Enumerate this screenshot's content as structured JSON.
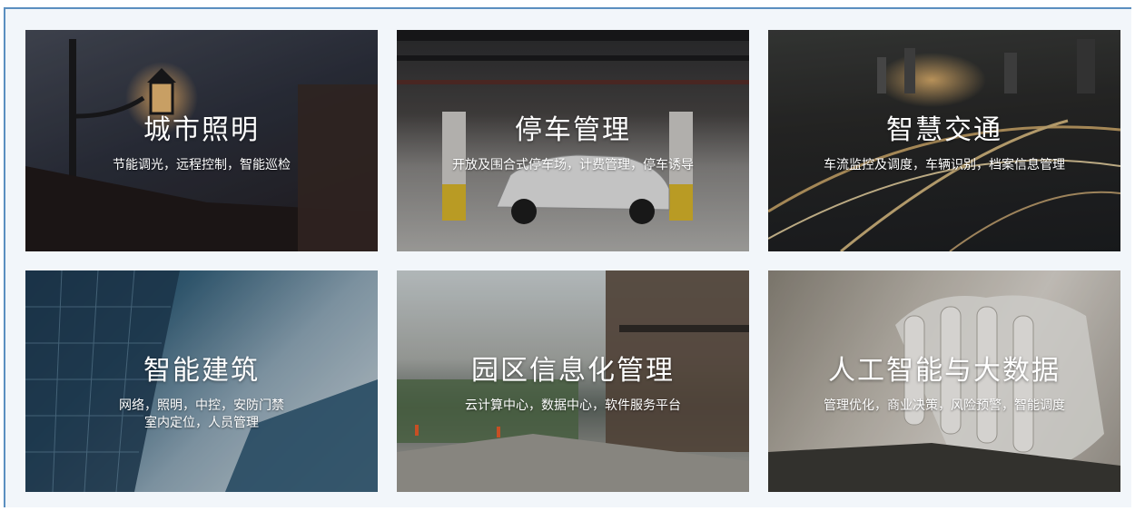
{
  "cards": [
    {
      "title": "城市照明",
      "desc": "节能调光，远程控制，智能巡检"
    },
    {
      "title": "停车管理",
      "desc": "开放及围合式停车场，计费管理，停车诱导"
    },
    {
      "title": "智慧交通",
      "desc": "车流监控及调度，车辆识别，档案信息管理"
    },
    {
      "title": "智能建筑",
      "desc": "网络，照明，中控，安防门禁\n室内定位，人员管理"
    },
    {
      "title": "园区信息化管理",
      "desc": "云计算中心，数据中心，软件服务平台"
    },
    {
      "title": "人工智能与大数据",
      "desc": "管理优化，商业决策，风险预警，智能调度"
    }
  ],
  "colors": {
    "frame_border": "#5b8fc0",
    "frame_bg": "#f2f6fa"
  }
}
